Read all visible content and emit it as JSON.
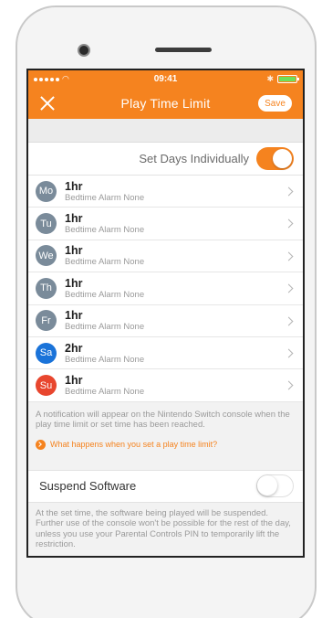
{
  "status_bar": {
    "time": "09:41"
  },
  "nav": {
    "title": "Play Time Limit",
    "save_label": "Save"
  },
  "set_days": {
    "label": "Set Days Individually",
    "enabled": true
  },
  "days": [
    {
      "abbr": "Mo",
      "limit": "1hr",
      "alarm": "Bedtime Alarm None",
      "color": "#7a8b9a"
    },
    {
      "abbr": "Tu",
      "limit": "1hr",
      "alarm": "Bedtime Alarm None",
      "color": "#7a8b9a"
    },
    {
      "abbr": "We",
      "limit": "1hr",
      "alarm": "Bedtime Alarm None",
      "color": "#7a8b9a"
    },
    {
      "abbr": "Th",
      "limit": "1hr",
      "alarm": "Bedtime Alarm None",
      "color": "#7a8b9a"
    },
    {
      "abbr": "Fr",
      "limit": "1hr",
      "alarm": "Bedtime Alarm None",
      "color": "#7a8b9a"
    },
    {
      "abbr": "Sa",
      "limit": "2hr",
      "alarm": "Bedtime Alarm None",
      "color": "#1a73d9"
    },
    {
      "abbr": "Su",
      "limit": "1hr",
      "alarm": "Bedtime Alarm None",
      "color": "#e8462e"
    }
  ],
  "notice": "A notification will appear on the Nintendo Switch console when the play time limit or set time has been reached.",
  "help_link": "What happens when you set a play time limit?",
  "suspend": {
    "label": "Suspend Software",
    "enabled": false,
    "notice": "At the set time, the software being played will be suspended. Further use of the console won't be possible for the rest of the day, unless you use your Parental Controls PIN to temporarily lift the restriction."
  },
  "colors": {
    "accent": "#f5831f"
  }
}
